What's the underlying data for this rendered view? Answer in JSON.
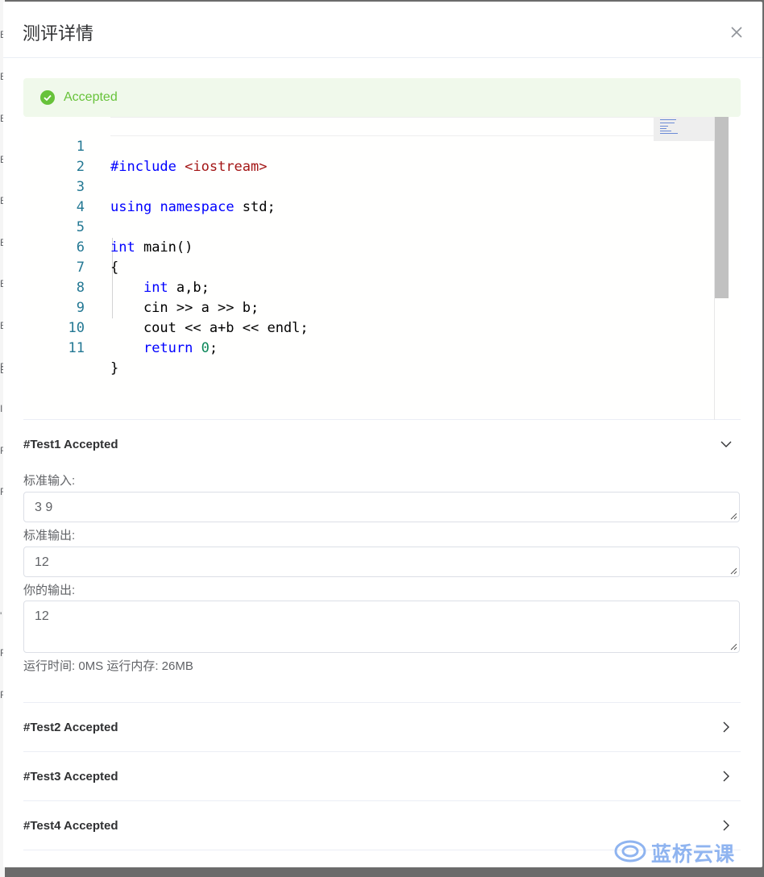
{
  "background_letters": [
    "E",
    "E",
    "E",
    "E",
    "E",
    "E",
    "E",
    "E",
    "E",
    "E",
    "I",
    "R",
    "R",
    "'",
    "R",
    "R"
  ],
  "dialog": {
    "title": "测评详情",
    "close_icon": "close-icon"
  },
  "alert": {
    "status": "Accepted",
    "icon": "check-circle-icon",
    "color": "#67c23a",
    "background": "#f0f9eb"
  },
  "editor": {
    "lines": [
      {
        "no": "1",
        "code": "#include <iostream>"
      },
      {
        "no": "2",
        "code": ""
      },
      {
        "no": "3",
        "code": "using namespace std;"
      },
      {
        "no": "4",
        "code": ""
      },
      {
        "no": "5",
        "code": "int main()"
      },
      {
        "no": "6",
        "code": "{"
      },
      {
        "no": "7",
        "code": "    int a,b;"
      },
      {
        "no": "8",
        "code": "    cin >> a >> b;"
      },
      {
        "no": "9",
        "code": "    cout << a+b << endl;"
      },
      {
        "no": "10",
        "code": "    return 0;"
      },
      {
        "no": "11",
        "code": "}"
      }
    ]
  },
  "tests": [
    {
      "title": "#Test1 Accepted",
      "expanded": true,
      "input_label": "标准输入:",
      "input_value": "3 9",
      "expected_label": "标准输出:",
      "expected_value": "12",
      "output_label": "你的输出:",
      "output_value": "12",
      "stats": "运行时间: 0MS 运行内存: 26MB"
    },
    {
      "title": "#Test2 Accepted",
      "expanded": false
    },
    {
      "title": "#Test3 Accepted",
      "expanded": false
    },
    {
      "title": "#Test4 Accepted",
      "expanded": false
    }
  ],
  "watermark": {
    "text": "蓝桥云课",
    "icon": "lanqiao-logo-icon"
  }
}
